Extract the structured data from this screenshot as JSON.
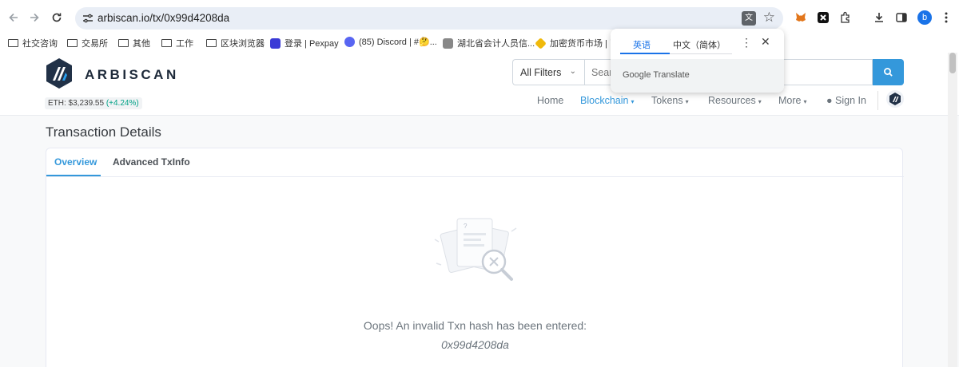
{
  "browser": {
    "url": "arbiscan.io/tx/0x99d4208da",
    "icons": [
      "back-icon",
      "forward-icon",
      "reload-icon",
      "site-info-icon",
      "translate-icon",
      "star-icon",
      "metamask-icon",
      "extension-icon",
      "puzzle-icon",
      "download-icon",
      "sidebar-icon",
      "menu-icon"
    ],
    "profile_initial": "b"
  },
  "bookmarks": [
    {
      "label": "社交咨询",
      "type": "folder"
    },
    {
      "label": "交易所",
      "type": "folder"
    },
    {
      "label": "其他",
      "type": "folder"
    },
    {
      "label": "工作",
      "type": "folder"
    },
    {
      "label": "区块浏览器",
      "type": "folder"
    },
    {
      "label": "登录 | Pexpay",
      "type": "link"
    },
    {
      "label": "(85) Discord | #🤔...",
      "type": "link"
    },
    {
      "label": "湖北省会计人员信...",
      "type": "link"
    },
    {
      "label": "加密货币市场 | 币...",
      "type": "link"
    }
  ],
  "translate_popup": {
    "tab_source": "英语",
    "tab_target": "中文（简体）",
    "brand": "Google Translate"
  },
  "site": {
    "logo_text": "ARBISCAN",
    "eth_label": "ETH: $3,239.55",
    "eth_change": "(+4.24%)",
    "filter_label": "All Filters",
    "search_placeholder": "Search",
    "nav": {
      "home": "Home",
      "blockchain": "Blockchain",
      "tokens": "Tokens",
      "resources": "Resources",
      "more": "More",
      "signin": "Sign In"
    }
  },
  "page": {
    "title": "Transaction Details",
    "tabs": {
      "overview": "Overview",
      "advanced": "Advanced TxInfo"
    },
    "error_message": "Oops! An invalid Txn hash has been entered:",
    "error_hash": "0x99d4208da"
  },
  "colors": {
    "accent": "#3498db",
    "positive": "#00a186",
    "chrome_blue": "#1a73e8"
  }
}
